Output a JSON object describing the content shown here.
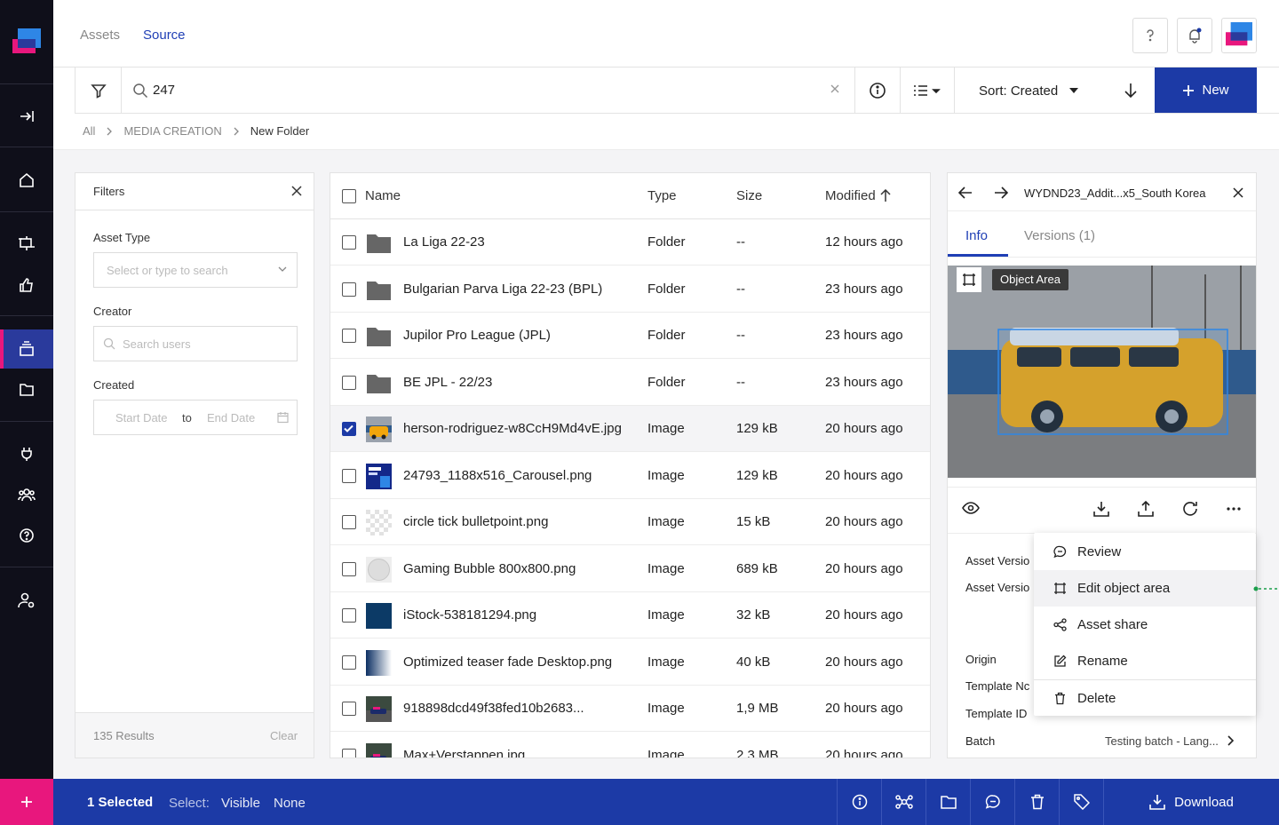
{
  "header": {
    "tabs": [
      "Assets",
      "Source"
    ],
    "active_tab": "Source"
  },
  "toolbar": {
    "search_value": "247",
    "sort_label": "Sort: Created",
    "new_label": "New"
  },
  "breadcrumb": [
    "All",
    "MEDIA CREATION",
    "New Folder"
  ],
  "filters": {
    "title": "Filters",
    "asset_type_label": "Asset Type",
    "asset_type_placeholder": "Select or type to search",
    "creator_label": "Creator",
    "creator_placeholder": "Search users",
    "created_label": "Created",
    "start_placeholder": "Start Date",
    "to_label": "to",
    "end_placeholder": "End Date",
    "results": "135 Results",
    "clear": "Clear"
  },
  "table": {
    "columns": [
      "Name",
      "Type",
      "Size",
      "Modified"
    ],
    "rows": [
      {
        "name": "La Liga 22-23",
        "type": "Folder",
        "size": "--",
        "modified": "12 hours ago",
        "thumb": "folder",
        "selected": false
      },
      {
        "name": "Bulgarian Parva Liga 22-23 (BPL)",
        "type": "Folder",
        "size": "--",
        "modified": "23 hours ago",
        "thumb": "folder",
        "selected": false
      },
      {
        "name": "Jupilor Pro League (JPL)",
        "type": "Folder",
        "size": "--",
        "modified": "23 hours ago",
        "thumb": "folder",
        "selected": false
      },
      {
        "name": "BE JPL - 22/23",
        "type": "Folder",
        "size": "--",
        "modified": "23 hours ago",
        "thumb": "folder",
        "selected": false
      },
      {
        "name": "herson-rodriguez-w8CcH9Md4vE.jpg",
        "type": "Image",
        "size": "129 kB",
        "modified": "20 hours ago",
        "thumb": "van",
        "selected": true
      },
      {
        "name": "24793_1188x516_Carousel.png",
        "type": "Image",
        "size": "129 kB",
        "modified": "20 hours ago",
        "thumb": "carousel",
        "selected": false
      },
      {
        "name": "circle tick bulletpoint.png",
        "type": "Image",
        "size": "15 kB",
        "modified": "20 hours ago",
        "thumb": "checker",
        "selected": false
      },
      {
        "name": "Gaming Bubble 800x800.png",
        "type": "Image",
        "size": "689 kB",
        "modified": "20 hours ago",
        "thumb": "bubble",
        "selected": false
      },
      {
        "name": "iStock-538181294.png",
        "type": "Image",
        "size": "32 kB",
        "modified": "20 hours ago",
        "thumb": "navy",
        "selected": false
      },
      {
        "name": "Optimized teaser fade Desktop.png",
        "type": "Image",
        "size": "40 kB",
        "modified": "20 hours ago",
        "thumb": "fade",
        "selected": false
      },
      {
        "name": "918898dcd49f38fed10b2683...",
        "type": "Image",
        "size": "1,9 MB",
        "modified": "20 hours ago",
        "thumb": "race",
        "selected": false
      },
      {
        "name": "Max+Verstappen.jpg",
        "type": "Image",
        "size": "2,3 MB",
        "modified": "20 hours ago",
        "thumb": "race",
        "selected": false
      }
    ]
  },
  "detail": {
    "title": "WYDND23_Addit...x5_South Korea",
    "tabs": [
      "Info",
      "Versions (1)"
    ],
    "tooltip": "Object Area",
    "meta_labels": [
      "Asset Versio",
      "Asset Versio",
      "Origin",
      "Template Nc",
      "Template ID",
      "Batch"
    ],
    "batch_value": "Testing batch - Lang..."
  },
  "menu": [
    "Review",
    "Edit object area",
    "Asset share",
    "Rename",
    "Delete"
  ],
  "bottombar": {
    "selected": "1 Selected",
    "select_label": "Select:",
    "visible": "Visible",
    "none": "None",
    "download": "Download"
  },
  "colors": {
    "primary": "#1c3aa6",
    "accent": "#e8177d",
    "nav_bg": "#0f0f1a",
    "active_tab": "#1f3fb5"
  }
}
